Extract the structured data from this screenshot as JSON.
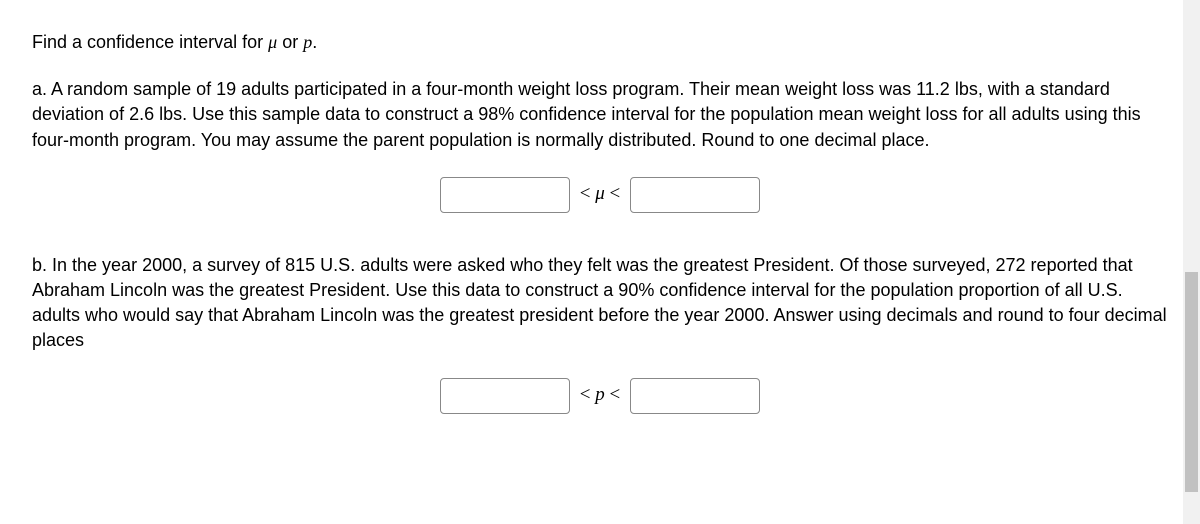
{
  "intro": {
    "prefix": "Find a confidence interval for ",
    "var1": "μ",
    "mid": " or ",
    "var2": "p",
    "suffix": "."
  },
  "questionA": {
    "text": "a. A random sample of 19 adults participated in a four-month weight loss program. Their mean weight loss was 11.2 lbs, with a standard deviation of 2.6 lbs. Use this sample data to construct a 98% confidence interval for the population mean weight loss for all adults using this four-month program. You may assume the parent population is normally distributed. Round to one decimal place.",
    "symbol_lt1": "<",
    "symbol_var": "μ",
    "symbol_lt2": "<"
  },
  "questionB": {
    "text": "b. In the year 2000, a survey of 815 U.S. adults were asked who they felt was the greatest President. Of those surveyed, 272 reported that Abraham Lincoln was the greatest President. Use this data to construct a 90% confidence interval for the population proportion of all U.S. adults who would say that Abraham Lincoln was the greatest president before the year 2000. Answer using decimals and round to four decimal places",
    "symbol_lt1": "<",
    "symbol_var": "p",
    "symbol_lt2": "<"
  }
}
